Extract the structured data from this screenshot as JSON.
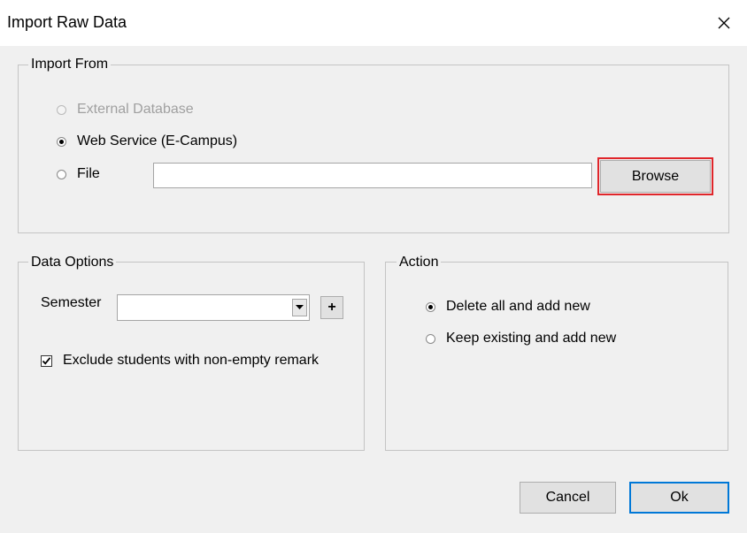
{
  "window": {
    "title": "Import Raw Data",
    "close_glyph": "✕"
  },
  "import_from": {
    "legend": "Import From",
    "options": [
      {
        "label": "External Database",
        "selected": false,
        "enabled": false
      },
      {
        "label": "Web Service (E-Campus)",
        "selected": true,
        "enabled": true
      },
      {
        "label": "File",
        "selected": false,
        "enabled": true
      }
    ],
    "file_path_value": "",
    "browse_label": "Browse"
  },
  "data_options": {
    "legend": "Data Options",
    "semester_label": "Semester",
    "semester_value": "",
    "add_semester_label": "+",
    "exclude_label": "Exclude students with non-empty remark",
    "exclude_checked": true
  },
  "action": {
    "legend": "Action",
    "options": [
      {
        "label": "Delete all and add new",
        "selected": true
      },
      {
        "label": "Keep existing and add new",
        "selected": false
      }
    ]
  },
  "footer": {
    "cancel_label": "Cancel",
    "ok_label": "Ok"
  },
  "colors": {
    "highlight": "#e0262b",
    "dialog_bg": "#f0f0f0",
    "default_button_border": "#0078d7"
  }
}
